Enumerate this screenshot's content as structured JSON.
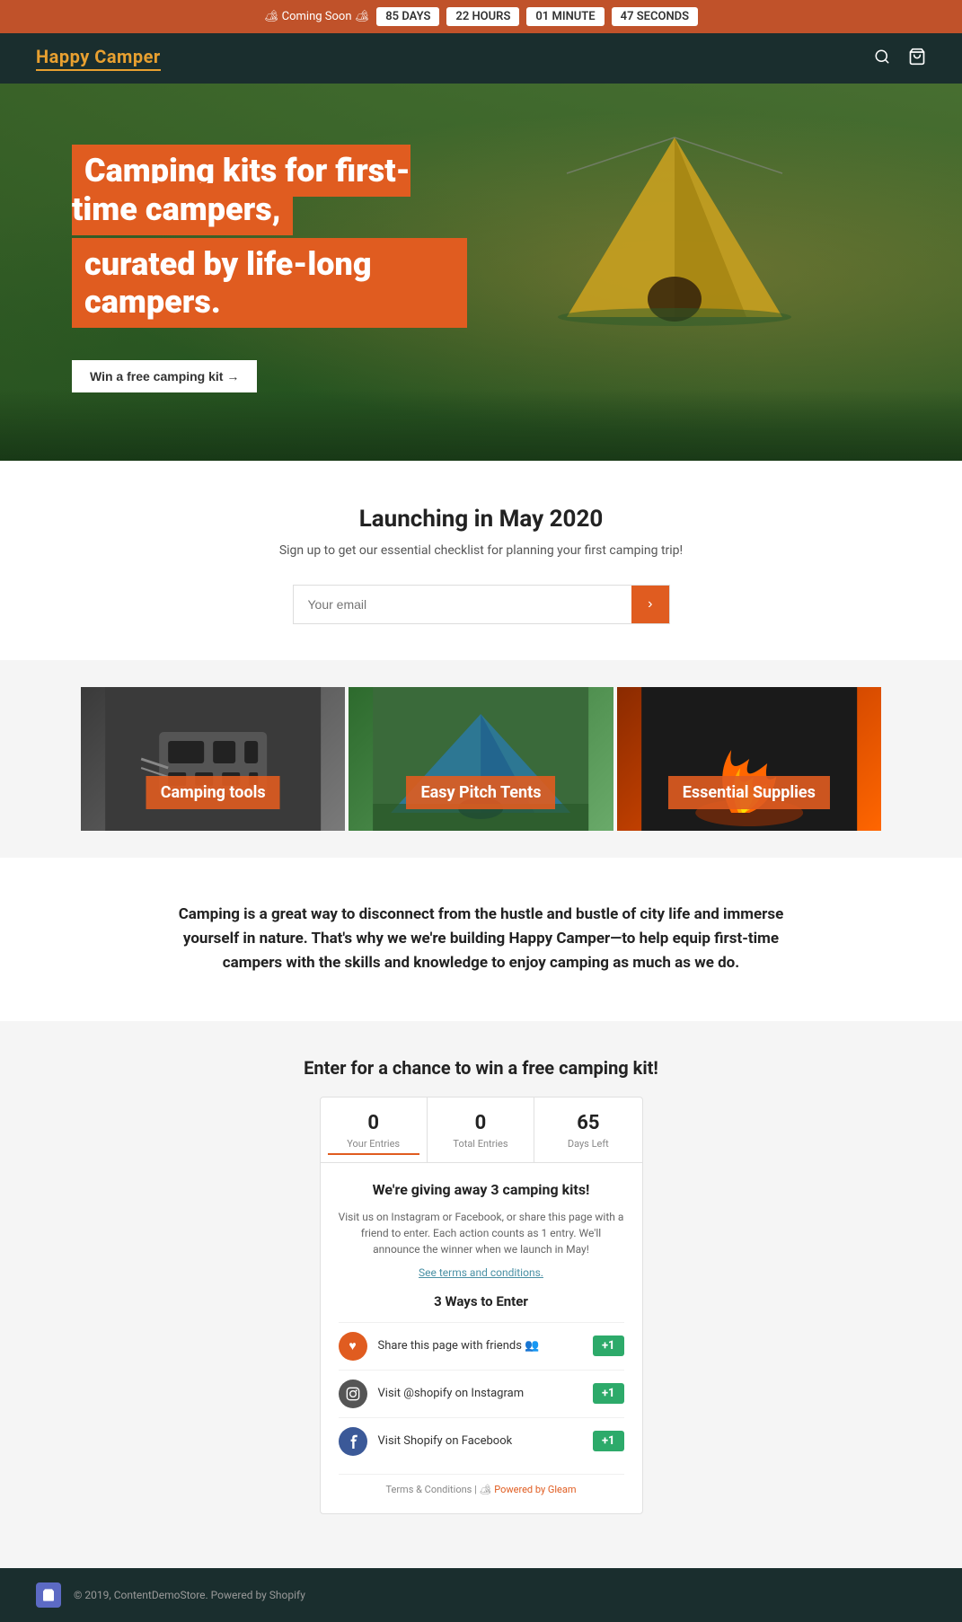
{
  "announcement": {
    "coming_soon": "🏕 Coming Soon 🏕",
    "days": "85 DAYS",
    "hours": "22 HOURS",
    "minutes": "01 MINUTE",
    "seconds": "47 SECONDS"
  },
  "header": {
    "logo": "Happy Camper"
  },
  "hero": {
    "title_line1": "Camping kits for first-time campers,",
    "title_line2": "curated by life-long campers.",
    "cta": "Win a free camping kit →"
  },
  "launch": {
    "title": "Launching in May 2020",
    "subtitle": "Sign up to get our essential checklist for planning your first camping trip!",
    "email_placeholder": "Your email"
  },
  "categories": [
    {
      "label": "Camping tools"
    },
    {
      "label": "Easy Pitch Tents"
    },
    {
      "label": "Essential Supplies"
    }
  ],
  "about": {
    "text": "Camping is a great way to disconnect from the hustle and bustle of city life and immerse yourself in nature. That's why we we're building Happy Camper—to help equip first-time campers with the skills and knowledge to enjoy camping as much as we do."
  },
  "giveaway": {
    "section_title": "Enter for a chance to win a free camping kit!",
    "stats": [
      {
        "number": "0",
        "label": "Your Entries",
        "active": true
      },
      {
        "number": "0",
        "label": "Total Entries",
        "active": false
      },
      {
        "number": "65",
        "label": "Days Left",
        "active": false
      }
    ],
    "heading": "We're giving away 3 camping kits!",
    "description": "Visit us on Instagram or Facebook, or share this page with a friend to enter. Each action counts as 1 entry. We'll announce the winner when we launch in May!",
    "terms_link": "See terms and conditions.",
    "ways_title": "3 Ways to Enter",
    "methods": [
      {
        "text": "Share this page with friends 👥",
        "points": "+1",
        "icon_type": "heart"
      },
      {
        "text": "Visit @shopify on Instagram",
        "points": "+1",
        "icon_type": "insta"
      },
      {
        "text": "Visit Shopify on Facebook",
        "points": "+1",
        "icon_type": "fb"
      }
    ],
    "footer": "Terms & Conditions | 🏕 Powered by Gleam"
  },
  "footer": {
    "copyright": "© 2019, ContentDemoStore. Powered by Shopify"
  }
}
